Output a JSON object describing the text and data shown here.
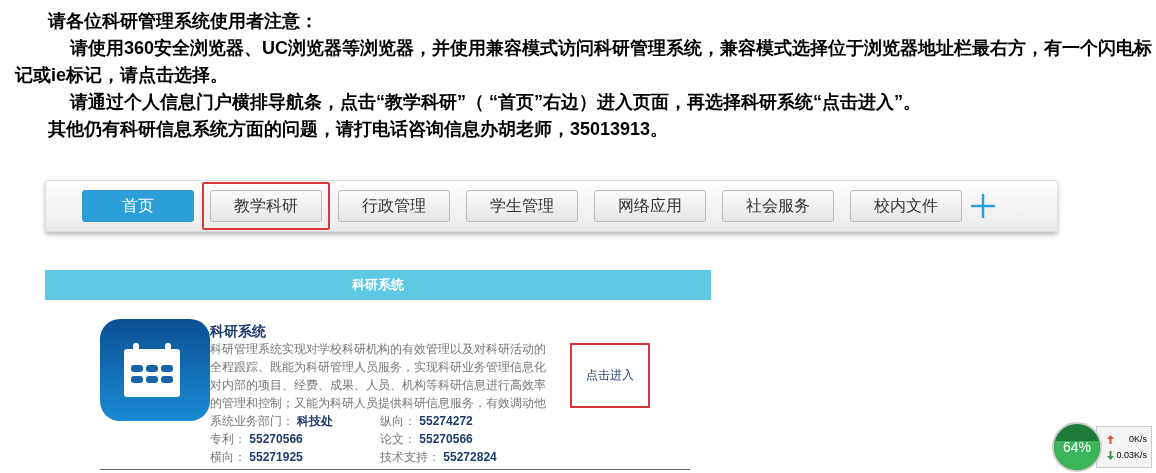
{
  "notice": {
    "title": "请各位科研管理系统使用者注意：",
    "paragraphs": [
      {
        "kind": "indented",
        "text": "请使用360安全浏览器、UC浏览器等浏览器，并使用兼容模式访问科研管理系统，兼容模式选择位于浏览器地址栏最右方，有一个闪电标记或ie标记，请点击选择。"
      },
      {
        "kind": "indented",
        "text": "请通过个人信息门户横排导航条，点击“教学科研”（ “首页”右边）进入页面，再选择科研系统“点击进入”。"
      },
      {
        "kind": "plain",
        "text": "其他仍有科研信息系统方面的问题，请打电话咨询信息办胡老师，35013913。"
      }
    ]
  },
  "nav": {
    "items": [
      {
        "label": "首页",
        "selected": true,
        "highlighted": false
      },
      {
        "label": "教学科研",
        "selected": false,
        "highlighted": true
      },
      {
        "label": "行政管理",
        "selected": false,
        "highlighted": false
      },
      {
        "label": "学生管理",
        "selected": false,
        "highlighted": false
      },
      {
        "label": "网络应用",
        "selected": false,
        "highlighted": false
      },
      {
        "label": "社会服务",
        "selected": false,
        "highlighted": false
      },
      {
        "label": "校内文件",
        "selected": false,
        "highlighted": false
      }
    ]
  },
  "section": {
    "header": "科研系统",
    "card": {
      "title": "科研系统",
      "description": "科研管理系统实现对学校科研机构的有效管理以及对科研活动的全程跟踪。既能为科研管理人员服务，实现科研业务管理信息化对内部的项目、经费、成果、人员、机构等科研信息进行高效率的管理和控制；又能为科研人员提供科研信息服务，有效调动他",
      "info": [
        {
          "label": "系统业务部门：",
          "value": "科技处"
        },
        {
          "label": "纵向：",
          "value": "55274272"
        },
        {
          "label": "专利：",
          "value": "55270566"
        },
        {
          "label": "论文：",
          "value": "55270566"
        },
        {
          "label": "横向：",
          "value": "55271925"
        },
        {
          "label": "技术支持：",
          "value": "55272824"
        }
      ],
      "enter_link": {
        "label": "点击进入",
        "highlighted": true
      }
    }
  },
  "speed_widget": {
    "percent": "64%",
    "upload": "0K/s",
    "download": "0.03K/s"
  }
}
